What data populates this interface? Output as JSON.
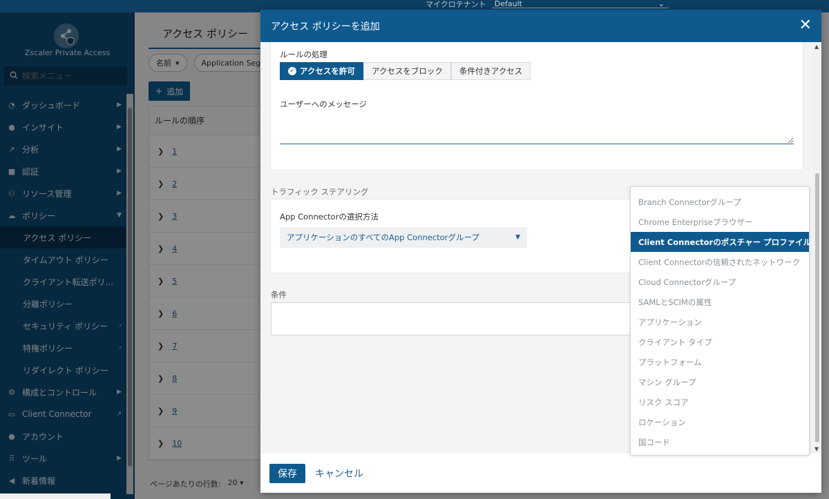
{
  "topbar": {
    "tenant_label": "マイクロテナント",
    "tenant_value": "Default"
  },
  "sidebar": {
    "brand": "Zscaler Private Access",
    "search_placeholder": "検索メニュー",
    "items": [
      {
        "label": "ダッシュボード",
        "icon": "dashboard-icon"
      },
      {
        "label": "インサイト",
        "icon": "lightbulb-icon"
      },
      {
        "label": "分析",
        "icon": "chart-icon"
      },
      {
        "label": "認証",
        "icon": "lock-icon"
      },
      {
        "label": "リソース管理",
        "icon": "sitemap-icon"
      },
      {
        "label": "ポリシー",
        "icon": "cloud-icon"
      },
      {
        "label": "アクセス ポリシー"
      },
      {
        "label": "タイムアウト ポリシー"
      },
      {
        "label": "クライアント転送ポリ..."
      },
      {
        "label": "分離ポリシー"
      },
      {
        "label": "セキュリティ ポリシー"
      },
      {
        "label": "特権ポリシー"
      },
      {
        "label": "リダイレクト ポリシー"
      },
      {
        "label": "構成とコントロール",
        "icon": "gears-icon"
      },
      {
        "label": "Client Connector",
        "icon": "monitor-icon"
      },
      {
        "label": "アカウント",
        "icon": "user-icon"
      },
      {
        "label": "ツール",
        "icon": "grid-icon"
      },
      {
        "label": "新着情報",
        "icon": "megaphone-icon"
      }
    ]
  },
  "main": {
    "tab_label": "アクセス ポリシー",
    "filter_name": "名前",
    "filter_segment": "Application Segm",
    "add_label": "追加",
    "table_header": "ルールの順序",
    "rows": [
      "1",
      "2",
      "3",
      "4",
      "5",
      "6",
      "7",
      "8",
      "9",
      "10"
    ],
    "pager_label": "ページあたりの行数:",
    "pager_value": "20"
  },
  "modal": {
    "title": "アクセス ポリシーを追加",
    "rule_action_label": "ルールの処理",
    "actions": [
      "アクセスを許可",
      "アクセスをブロック",
      "条件付きアクセス"
    ],
    "user_message_label": "ユーザーへのメッセージ",
    "traffic_steering_title": "トラフィック ステアリング",
    "app_connector_label": "App Connectorの選択方法",
    "app_connector_value": "アプリケーションのすべてのApp Connectorグループ",
    "conditions_title": "条件",
    "save_label": "保存",
    "cancel_label": "キャンセル"
  },
  "dropdown": {
    "items": [
      "Branch Connectorグループ",
      "Chrome Enterpriseブラウザー",
      "Client Connectorのポスチャー プロファイル",
      "Client Connectorの信頼されたネットワーク",
      "Cloud Connectorグループ",
      "SAMLとSCIMの属性",
      "アプリケーション",
      "クライアント タイプ",
      "プラットフォーム",
      "マシン グループ",
      "リスク スコア",
      "ロケーション",
      "国コード"
    ],
    "selected": "Client Connectorのポスチャー プロファイル"
  },
  "colors": {
    "accent": "#0e5a8f",
    "sidebar": "#0e4b75"
  }
}
